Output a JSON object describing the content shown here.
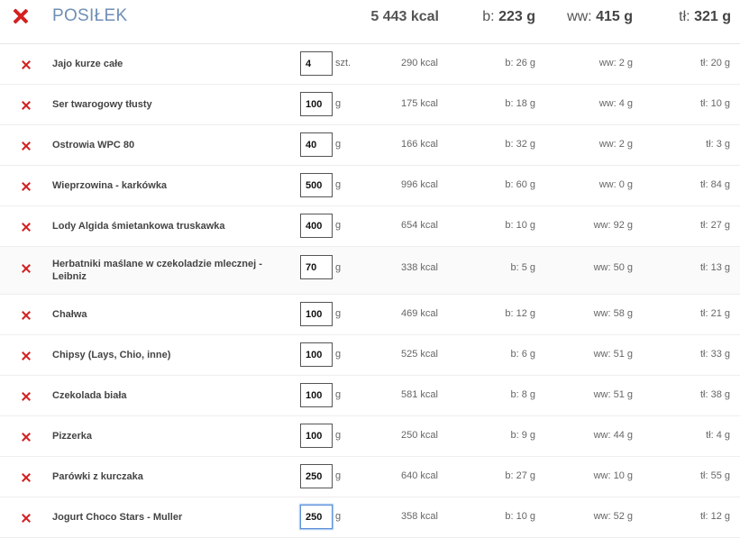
{
  "meal": {
    "title": "POSIŁEK",
    "total_kcal": "5 443 kcal",
    "protein_label": "b:",
    "protein_value": "223 g",
    "carbs_label": "ww:",
    "carbs_value": "415 g",
    "fat_label": "tł:",
    "fat_value": "321 g"
  },
  "colors": {
    "title": "#6e8fb5",
    "remove_icon": "#d42020"
  },
  "items": [
    {
      "name": "Jajo kurze całe",
      "qty": "4",
      "unit": "szt.",
      "kcal": "290 kcal",
      "b": "b: 26 g",
      "ww": "ww: 2 g",
      "tl": "tł: 20 g"
    },
    {
      "name": "Ser twarogowy tłusty",
      "qty": "100",
      "unit": "g",
      "kcal": "175 kcal",
      "b": "b: 18 g",
      "ww": "ww: 4 g",
      "tl": "tł: 10 g"
    },
    {
      "name": "Ostrowia WPC 80",
      "qty": "40",
      "unit": "g",
      "kcal": "166 kcal",
      "b": "b: 32 g",
      "ww": "ww: 2 g",
      "tl": "tł: 3 g"
    },
    {
      "name": "Wieprzowina - karkówka",
      "qty": "500",
      "unit": "g",
      "kcal": "996 kcal",
      "b": "b: 60 g",
      "ww": "ww: 0 g",
      "tl": "tł: 84 g"
    },
    {
      "name": "Lody Algida śmietankowa truskawka",
      "qty": "400",
      "unit": "g",
      "kcal": "654 kcal",
      "b": "b: 10 g",
      "ww": "ww: 92 g",
      "tl": "tł: 27 g"
    },
    {
      "name": "Herbatniki maślane w czekoladzie mlecznej - Leibniz",
      "qty": "70",
      "unit": "g",
      "kcal": "338 kcal",
      "b": "b: 5 g",
      "ww": "ww: 50 g",
      "tl": "tł: 13 g"
    },
    {
      "name": "Chałwa",
      "qty": "100",
      "unit": "g",
      "kcal": "469 kcal",
      "b": "b: 12 g",
      "ww": "ww: 58 g",
      "tl": "tł: 21 g"
    },
    {
      "name": "Chipsy (Lays, Chio, inne)",
      "qty": "100",
      "unit": "g",
      "kcal": "525 kcal",
      "b": "b: 6 g",
      "ww": "ww: 51 g",
      "tl": "tł: 33 g"
    },
    {
      "name": "Czekolada biała",
      "qty": "100",
      "unit": "g",
      "kcal": "581 kcal",
      "b": "b: 8 g",
      "ww": "ww: 51 g",
      "tl": "tł: 38 g"
    },
    {
      "name": "Pizzerka",
      "qty": "100",
      "unit": "g",
      "kcal": "250 kcal",
      "b": "b: 9 g",
      "ww": "ww: 44 g",
      "tl": "tł: 4 g"
    },
    {
      "name": "Parówki z kurczaka",
      "qty": "250",
      "unit": "g",
      "kcal": "640 kcal",
      "b": "b: 27 g",
      "ww": "ww: 10 g",
      "tl": "tł: 55 g"
    },
    {
      "name": "Jogurt Choco Stars - Muller",
      "qty": "250",
      "unit": "g",
      "kcal": "358 kcal",
      "b": "b: 10 g",
      "ww": "ww: 52 g",
      "tl": "tł: 12 g"
    }
  ]
}
